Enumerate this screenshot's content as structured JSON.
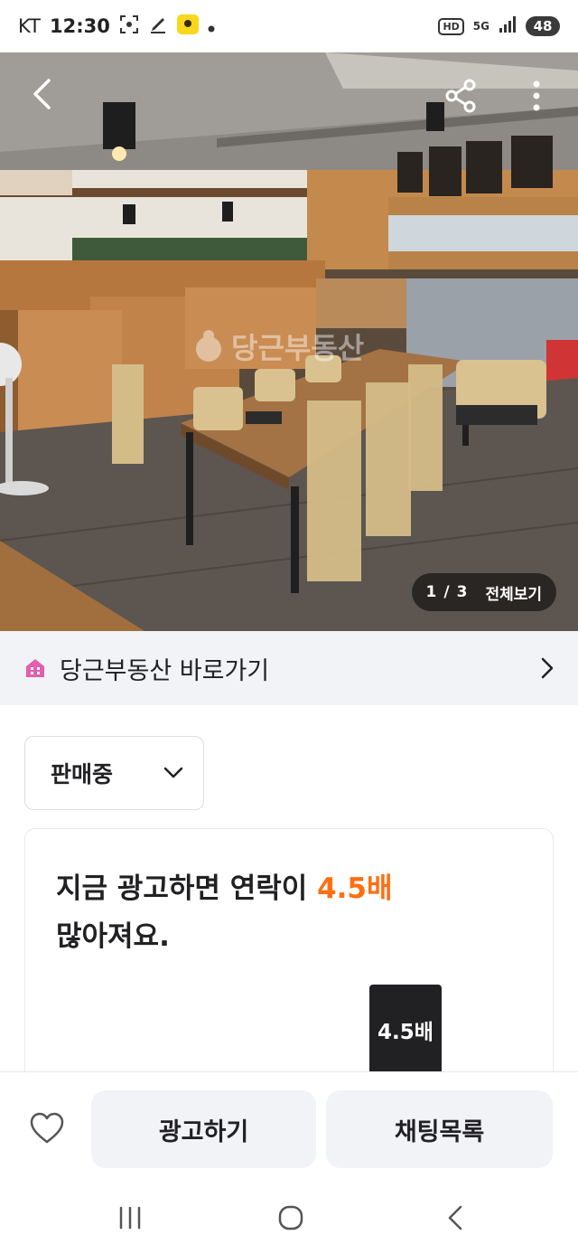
{
  "status_bar": {
    "carrier": "KT",
    "time": "12:30",
    "hd": "HD",
    "network": "5G",
    "battery": "48"
  },
  "photo": {
    "counter_current": "1",
    "counter_total": "3",
    "view_all": "전체보기",
    "watermark": "당근부동산"
  },
  "realty_banner": {
    "label": "당근부동산 바로가기"
  },
  "status_select": {
    "value": "판매중"
  },
  "ad_card": {
    "title_part1": "지금 광고하면 연락이 ",
    "title_highlight": "4.5배",
    "title_part2": "많아져요.",
    "bar_big_label": "4.5배",
    "highlight_color": "#ff6f0f"
  },
  "actions": {
    "ad_button": "광고하기",
    "chat_button": "채팅목록"
  },
  "colors": {
    "accent": "#ff6f0f",
    "realty_icon": "#e05fb0",
    "text": "#212124",
    "surface": "#f2f3f6"
  }
}
